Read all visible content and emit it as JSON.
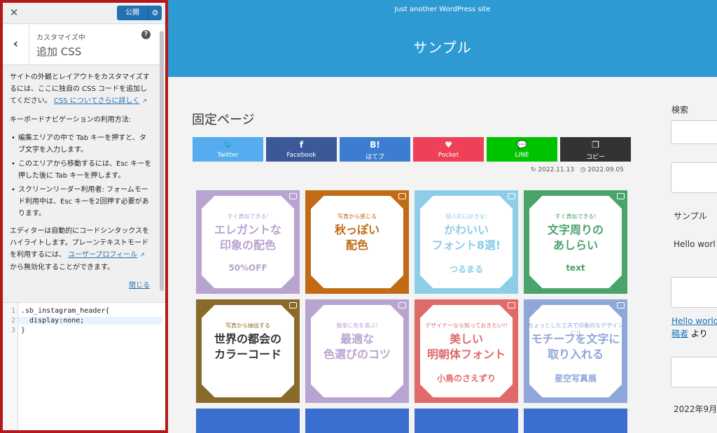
{
  "customizer": {
    "publish_label": "公開",
    "subtitle": "カスタマイズ中",
    "section_title": "追加 CSS",
    "desc_part1": "サイトの外観とレイアウトをカスタマイズするには、ここに独自の CSS コードを追加してください。",
    "desc_link": "CSS についてさらに詳しく",
    "kbd_title": "キーボードナビゲーションの利用方法:",
    "kbd_items": [
      "編集エリアの中で Tab キーを押すと、タブ文字を入力します。",
      "このエリアから移動するには、Esc キーを押した後に Tab キーを押します。",
      "スクリーンリーダー利用者: フォームモード利用中は、Esc キーを2回押す必要があります。"
    ],
    "editor_part1": "エディターは自動的にコードシンタックスをハイライトします。プレーンテキストモードを利用するには、",
    "editor_link1": "ユーザープロフィール",
    "editor_part2": "から無効化することができます。",
    "close_link": "閉じる",
    "code_lines": [
      {
        "num": "1",
        "text": ".sb_instagram_header{"
      },
      {
        "num": "2",
        "text": "  display:none;"
      },
      {
        "num": "3",
        "text": "}"
      }
    ]
  },
  "preview": {
    "tagline": "Just another WordPress site",
    "site_title": "サンプル",
    "page_heading": "固定ページ",
    "share_buttons": [
      {
        "icon": "🐦",
        "label": "Twitter",
        "color": "#55acee"
      },
      {
        "icon": "f",
        "label": "Facebook",
        "color": "#3b5998"
      },
      {
        "icon": "B!",
        "label": "はてブ",
        "color": "#3c7dd1"
      },
      {
        "icon": "♥",
        "label": "Pocket",
        "color": "#ee4056"
      },
      {
        "icon": "💬",
        "label": "LINE",
        "color": "#00c300"
      },
      {
        "icon": "❐",
        "label": "コピー",
        "color": "#333333"
      }
    ],
    "date_updated": "2022.11.13",
    "date_published": "2022.09.05",
    "tiles": [
      {
        "small": "すぐ真似できる!",
        "big": "エレガントな\n印象の配色",
        "extra": "50%OFF",
        "color": "#b9a3d1"
      },
      {
        "small": "写真から感じる",
        "big": "秋っぽい\n配色",
        "extra": "",
        "color": "#c26a14"
      },
      {
        "small": "個人的に好きな!",
        "big": "かわいい\nフォント8選!",
        "extra": "つるまる",
        "color": "#8ecde8"
      },
      {
        "small": "すぐ真似できる!",
        "big": "文字周りの\nあしらい",
        "extra": "text",
        "color": "#4aa36b"
      },
      {
        "small": "写真から抽出する",
        "big": "世界の都会の\nカラーコード",
        "extra": "",
        "color": "#8a6a2a"
      },
      {
        "small": "簡単に色を選ぶ!",
        "big": "最適な\n色選びのコツ",
        "extra": "",
        "color": "#b9a3d1"
      },
      {
        "small": "デザイナーなら知っておきたい!!",
        "big": "美しい\n明朝体フォント",
        "extra": "小鳥のさえずり",
        "color": "#e06a6a"
      },
      {
        "small": "ちょっとした工夫で印象的なデザインに!!",
        "big": "モチーフを文字に\n取り入れる",
        "extra": "星空写真展",
        "color": "#8fa6d8"
      }
    ],
    "sidebar": {
      "search_label": "検索",
      "recent_title": "サンプル",
      "recent_text": "Hello worl",
      "comment_link": "Hello world",
      "comment_link2": "稿者",
      "comment_suffix": "より",
      "archive": "2022年9月"
    }
  }
}
